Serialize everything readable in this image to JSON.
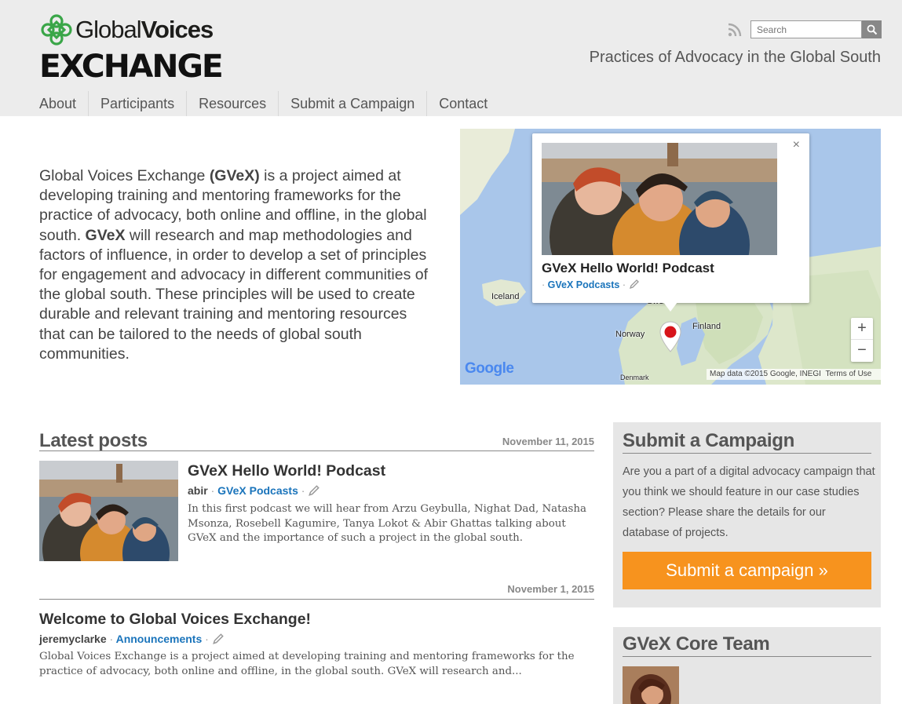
{
  "header": {
    "logo_top_regular": "Global",
    "logo_top_bold": "Voices",
    "logo_exchange": "EXCHANGE",
    "search_placeholder": "Search",
    "tagline": "Practices of Advocacy in the Global South"
  },
  "nav": {
    "items": [
      "About",
      "Participants",
      "Resources",
      "Submit a Campaign",
      "Contact"
    ]
  },
  "intro": {
    "p1": "Global Voices Exchange ",
    "b1": "(GVeX)",
    "p2": " is a project aimed at developing training and mentoring frameworks for the practice of advocacy, both online and offline, in the global south. ",
    "b2": "GVeX",
    "p3": " will research and map methodologies and factors of influence, in order to develop a set of principles for engagement and advocacy in different communities of the global south. These principles will be used to create durable and relevant training and mentoring resources that can be tailored to the needs of global south communities."
  },
  "map": {
    "popup_title": "GVeX Hello World! Podcast",
    "popup_bullet": "·",
    "popup_category": "GVeX Podcasts",
    "close": "×",
    "labels": {
      "iceland": "Iceland",
      "norway": "Norway",
      "finland": "Finland",
      "denmark": "Denmark",
      "sweden": "Swe"
    },
    "zoom_in": "+",
    "zoom_out": "−",
    "google": "Google",
    "attribution": "Map data ©2015 Google, INEGI",
    "terms": "Terms of Use"
  },
  "latest": {
    "title": "Latest posts",
    "posts": [
      {
        "date": "November 11, 2015",
        "title": "GVeX Hello World! Podcast",
        "author": "abir",
        "sep": "·",
        "category": "GVeX Podcasts",
        "excerpt": "In this first podcast we will hear from Arzu Geybulla, Nighat Dad, Natasha Msonza, Rosebell Kagumire, Tanya Lokot & Abir Ghattas talking about GVeX and the importance of such a project in the global south."
      },
      {
        "date": "November 1, 2015",
        "title": "Welcome to Global Voices Exchange!",
        "author": "jeremyclarke",
        "sep": "·",
        "category": "Announcements",
        "excerpt": "Global Voices Exchange  is a project aimed at developing training and mentoring frameworks for the practice of advocacy, both online and offline, in the global south. GVeX will research and..."
      }
    ]
  },
  "sidebar": {
    "campaign_title": "Submit a Campaign",
    "campaign_text": "Are you a part of a digital advocacy campaign that you think we should feature in our case studies section? Please share the details for our database of projects.",
    "campaign_button": "Submit a campaign »",
    "team_title": "GVeX Core Team"
  },
  "colors": {
    "accent": "#f7931e",
    "link": "#1a74bb",
    "header_bg": "#ececec",
    "logo_green": "#3aa648"
  }
}
